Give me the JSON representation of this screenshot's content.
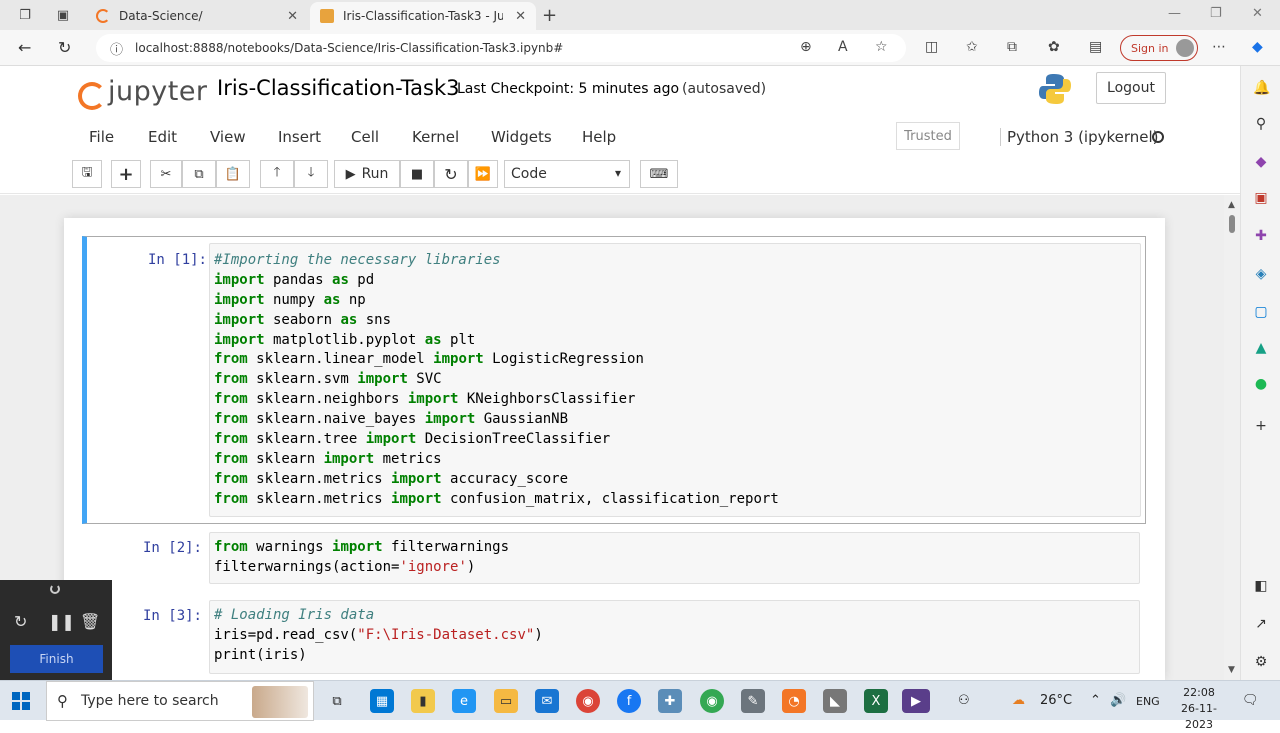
{
  "browser": {
    "tabs": [
      {
        "title": "Data-Science/",
        "active": false
      },
      {
        "title": "Iris-Classification-Task3 - Jupyter",
        "active": true
      }
    ],
    "url": "localhost:8888/notebooks/Data-Science/Iris-Classification-Task3.ipynb#",
    "sign_in": "Sign in"
  },
  "jupyter": {
    "logo_text": "jupyter",
    "notebook_title": "Iris-Classification-Task3",
    "checkpoint": "Last Checkpoint: 5 minutes ago",
    "autosave": "(autosaved)",
    "logout": "Logout",
    "menu": [
      "File",
      "Edit",
      "View",
      "Insert",
      "Cell",
      "Kernel",
      "Widgets",
      "Help"
    ],
    "trusted": "Trusted",
    "kernel": "Python 3 (ipykernel)",
    "toolbar": {
      "run_label": "Run",
      "cell_type": "Code"
    }
  },
  "cells": [
    {
      "prompt": "In [1]:",
      "lines": [
        [
          {
            "t": "#Importing the necessary libraries",
            "c": "cm"
          }
        ],
        [
          {
            "t": "import",
            "c": "kw"
          },
          {
            "t": " pandas "
          },
          {
            "t": "as",
            "c": "kw"
          },
          {
            "t": " pd"
          }
        ],
        [
          {
            "t": "import",
            "c": "kw"
          },
          {
            "t": " numpy "
          },
          {
            "t": "as",
            "c": "kw"
          },
          {
            "t": " np"
          }
        ],
        [
          {
            "t": "import",
            "c": "kw"
          },
          {
            "t": " seaborn "
          },
          {
            "t": "as",
            "c": "kw"
          },
          {
            "t": " sns"
          }
        ],
        [
          {
            "t": "import",
            "c": "kw"
          },
          {
            "t": " matplotlib.pyplot "
          },
          {
            "t": "as",
            "c": "kw"
          },
          {
            "t": " plt"
          }
        ],
        [
          {
            "t": "from",
            "c": "kw"
          },
          {
            "t": " sklearn.linear_model "
          },
          {
            "t": "import",
            "c": "kw"
          },
          {
            "t": " LogisticRegression"
          }
        ],
        [
          {
            "t": "from",
            "c": "kw"
          },
          {
            "t": " sklearn.svm "
          },
          {
            "t": "import",
            "c": "kw"
          },
          {
            "t": " SVC"
          }
        ],
        [
          {
            "t": "from",
            "c": "kw"
          },
          {
            "t": " sklearn.neighbors "
          },
          {
            "t": "import",
            "c": "kw"
          },
          {
            "t": " KNeighborsClassifier"
          }
        ],
        [
          {
            "t": "from",
            "c": "kw"
          },
          {
            "t": " sklearn.naive_bayes "
          },
          {
            "t": "import",
            "c": "kw"
          },
          {
            "t": " GaussianNB"
          }
        ],
        [
          {
            "t": "from",
            "c": "kw"
          },
          {
            "t": " sklearn.tree "
          },
          {
            "t": "import",
            "c": "kw"
          },
          {
            "t": " DecisionTreeClassifier"
          }
        ],
        [
          {
            "t": "from",
            "c": "kw"
          },
          {
            "t": " sklearn "
          },
          {
            "t": "import",
            "c": "kw"
          },
          {
            "t": " metrics"
          }
        ],
        [
          {
            "t": "from",
            "c": "kw"
          },
          {
            "t": " sklearn.metrics "
          },
          {
            "t": "import",
            "c": "kw"
          },
          {
            "t": " accuracy_score"
          }
        ],
        [
          {
            "t": "from",
            "c": "kw"
          },
          {
            "t": " sklearn.metrics "
          },
          {
            "t": "import",
            "c": "kw"
          },
          {
            "t": " confusion_matrix, classification_report"
          }
        ]
      ]
    },
    {
      "prompt": "In [2]:",
      "lines": [
        [
          {
            "t": "from",
            "c": "kw"
          },
          {
            "t": " warnings "
          },
          {
            "t": "import",
            "c": "kw"
          },
          {
            "t": " filterwarnings"
          }
        ],
        [
          {
            "t": "filterwarnings(action="
          },
          {
            "t": "'ignore'",
            "c": "st"
          },
          {
            "t": ")"
          }
        ]
      ]
    },
    {
      "prompt": "In [3]:",
      "lines": [
        [
          {
            "t": "# Loading Iris data",
            "c": "cm"
          }
        ],
        [
          {
            "t": "iris=pd.read_csv("
          },
          {
            "t": "\"F:\\Iris-Dataset.csv\"",
            "c": "st"
          },
          {
            "t": ")"
          }
        ],
        [
          {
            "t": "print(iris)"
          }
        ]
      ]
    }
  ],
  "recorder": {
    "finish_label": "Finish"
  },
  "taskbar": {
    "search_placeholder": "Type here to search",
    "temperature": "26°C",
    "language": "ENG",
    "time": "22:08",
    "date": "26-11-2023"
  },
  "colors": {
    "jupyter_orange": "#f37626",
    "selected_cell_border": "#42a5f5",
    "keyword_green": "#008000",
    "prompt_blue": "#303f9f"
  }
}
